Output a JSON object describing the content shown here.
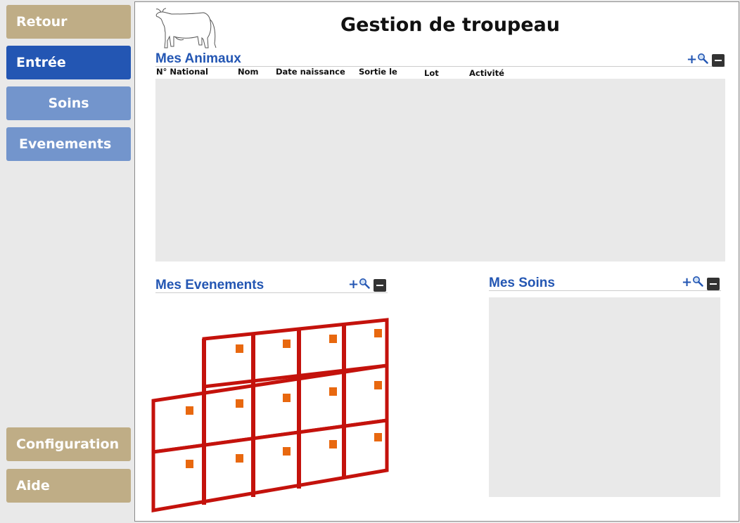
{
  "sidebar": {
    "back_label": "Retour",
    "entree_label": "Entrée",
    "soins_label": "Soins",
    "evenements_label": "Evenements",
    "configuration_label": "Configuration",
    "aide_label": "Aide"
  },
  "header": {
    "title": "Gestion de troupeau"
  },
  "animaux": {
    "title": "Mes Animaux",
    "add_label": "+",
    "columns": [
      "N° National",
      "Nom",
      "Date naissance",
      "Sortie le",
      "Lot",
      "Activité"
    ]
  },
  "evenements": {
    "title": "Mes Evenements",
    "add_label": "+"
  },
  "soins": {
    "title": "Mes Soins",
    "add_label": "+"
  },
  "icons": {
    "search": "search-icon",
    "collapse": "minus-icon",
    "cow": "cow-icon",
    "calendar": "calendar-icon"
  },
  "colors": {
    "accent": "#2356b3",
    "nav_tan": "#bfad86",
    "nav_active": "#2356b3",
    "nav_sub": "#7395cc",
    "calendar_red": "#c4120c",
    "calendar_mark": "#e8680f"
  }
}
